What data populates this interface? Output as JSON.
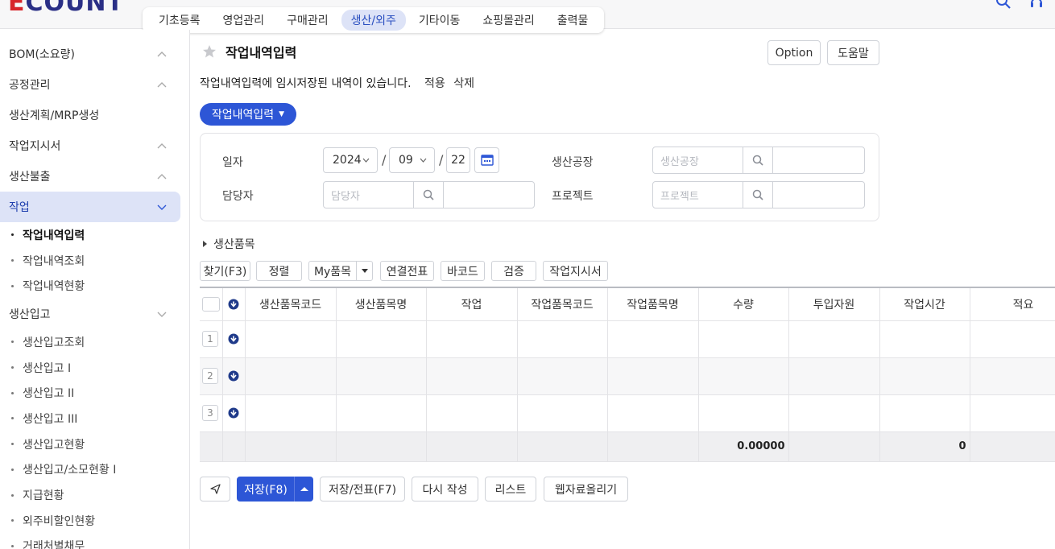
{
  "logo": {
    "text_e": "E",
    "text_rest": "COUNT"
  },
  "topnav": {
    "items": [
      {
        "label": "기초등록"
      },
      {
        "label": "영업관리"
      },
      {
        "label": "구매관리"
      },
      {
        "label": "생산/외주",
        "active": true
      },
      {
        "label": "기타이동"
      },
      {
        "label": "쇼핑몰관리"
      },
      {
        "label": "출력물"
      }
    ]
  },
  "sidebar": {
    "groups": [
      {
        "label": "BOM(소요량)"
      },
      {
        "label": "공정관리"
      },
      {
        "label": "생산계획/MRP생성"
      },
      {
        "label": "작업지시서"
      },
      {
        "label": "생산불출"
      },
      {
        "label": "작업"
      }
    ],
    "work_items": [
      {
        "label": "작업내역입력"
      },
      {
        "label": "작업내역조회"
      },
      {
        "label": "작업내역현황"
      }
    ],
    "receiving_group": {
      "label": "생산입고"
    },
    "receiving_items": [
      {
        "label": "생산입고조회"
      },
      {
        "label": "생산입고 I"
      },
      {
        "label": "생산입고 II"
      },
      {
        "label": "생산입고 III"
      },
      {
        "label": "생산입고현황"
      },
      {
        "label": "생산입고/소모현황 I"
      },
      {
        "label": "지급현황"
      },
      {
        "label": "외주비할인현황"
      },
      {
        "label": "거래처별채무"
      }
    ]
  },
  "page": {
    "title": "작업내역입력",
    "option_label": "Option",
    "help_label": "도움말",
    "notice": "작업내역입력에 임시저장된 내역이 있습니다.",
    "apply_label": "적용",
    "delete_label": "삭제",
    "dropdown_label": "작업내역입력"
  },
  "form": {
    "date_label": "일자",
    "year": "2024",
    "month": "09",
    "day": "22",
    "manager_label": "담당자",
    "manager_placeholder": "담당자",
    "factory_label": "생산공장",
    "factory_placeholder": "생산공장",
    "project_label": "프로젝트",
    "project_placeholder": "프로젝트"
  },
  "section": {
    "label": "생산품목"
  },
  "toolbar": {
    "find": "찾기(F3)",
    "sort": "정렬",
    "my_items": "My품목",
    "linked_slip": "연결전표",
    "barcode": "바코드",
    "verify": "검증",
    "work_order": "작업지시서"
  },
  "grid": {
    "columns": [
      "생산품목코드",
      "생산품목명",
      "작업",
      "작업품목코드",
      "작업품목명",
      "수량",
      "투입자원",
      "작업시간",
      "적요"
    ],
    "rows": [
      "1",
      "2",
      "3"
    ],
    "total_qty": "0.00000",
    "total_time": "0"
  },
  "bottom": {
    "save": "저장(F8)",
    "save_slip": "저장/전표(F7)",
    "rewrite": "다시 작성",
    "list": "리스트",
    "web_upload": "웹자료올리기"
  },
  "colors": {
    "primary": "#2d56d6",
    "active_bg": "#dde3f7"
  }
}
